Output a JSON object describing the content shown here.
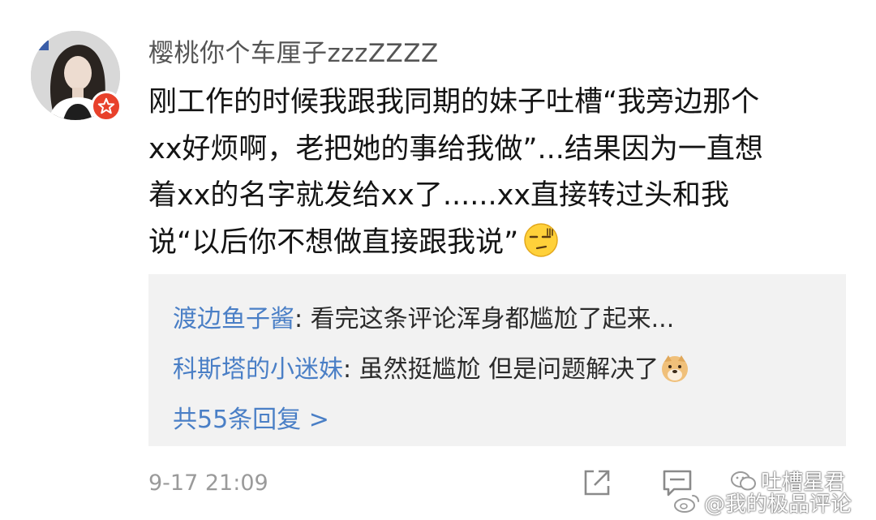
{
  "post": {
    "username": "樱桃你个车厘子zzzZZZZ",
    "comment_lines": [
      "刚工作的时候我跟我同期的妹子吐槽“我旁边那个",
      "xx好烦啊，老把她的事给我做”...结果因为一直想",
      "着xx的名字就发给xx了......xx直接转过头和我",
      "说“以后你不想做直接跟我说”"
    ],
    "emoji": "speechless-face-emoji",
    "timestamp": "9-17 21:09"
  },
  "replies": {
    "items": [
      {
        "name": "渡边鱼子酱",
        "text": ": 看完这条评论浑身都尴尬了起来..."
      },
      {
        "name": "科斯塔的小迷妹",
        "text": ": 虽然挺尴尬 但是问题解决了"
      }
    ],
    "more": "共55条回复 >"
  },
  "watermarks": {
    "wechat": "吐槽星君",
    "weibo": "@我的极品评论"
  },
  "colors": {
    "link_blue": "#4a7fc6",
    "reply_bg": "#f2f2f2",
    "badge_red": "#e8412b",
    "meta_gray": "#9a9a9a"
  },
  "icons": [
    "share-icon",
    "comment-icon",
    "verified-badge-icon",
    "wechat-icon",
    "weibo-icon",
    "doge-emoji"
  ]
}
